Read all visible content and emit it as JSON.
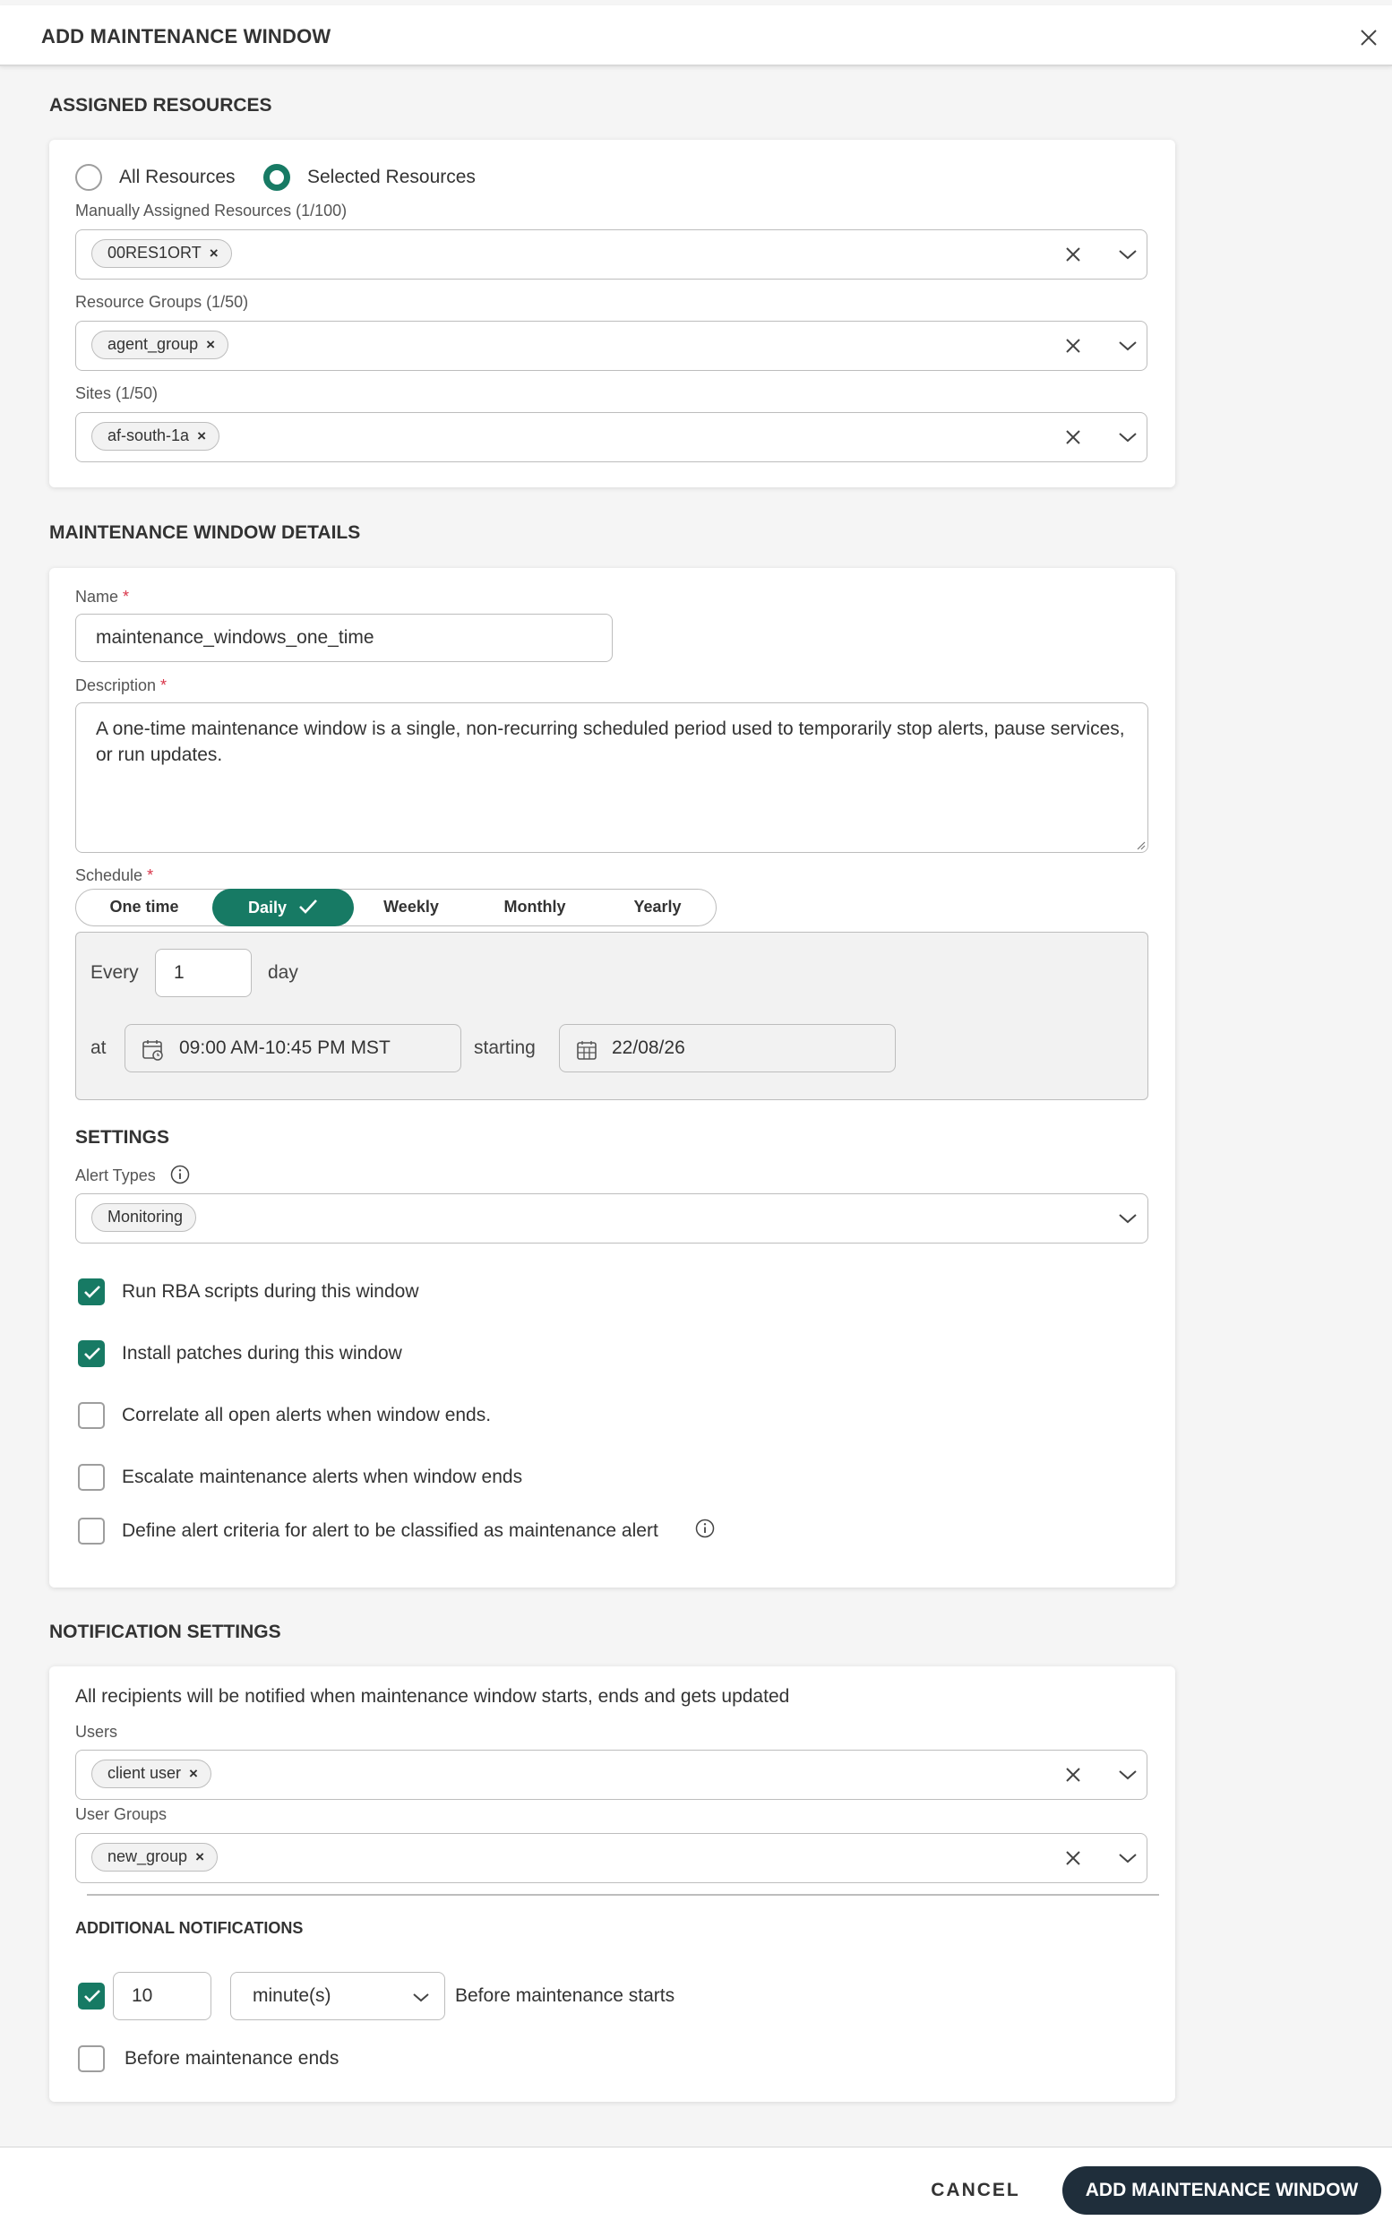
{
  "header": {
    "title": "ADD MAINTENANCE WINDOW"
  },
  "assigned": {
    "section_title": "ASSIGNED RESOURCES",
    "radio_all": "All Resources",
    "radio_selected": "Selected Resources",
    "selected_mode": "Selected Resources",
    "manual_label": "Manually Assigned Resources (1/100)",
    "manual_chip": "00RES1ORT",
    "groups_label": "Resource Groups (1/50)",
    "groups_chip": "agent_group",
    "sites_label": "Sites (1/50)",
    "sites_chip": "af-south-1a"
  },
  "details": {
    "section_title": "MAINTENANCE WINDOW DETAILS",
    "name_label": "Name",
    "name_value": "maintenance_windows_one_time",
    "desc_label": "Description",
    "desc_value": "A one-time maintenance window is a single, non-recurring scheduled period used to temporarily stop alerts, pause services, or run updates.",
    "schedule_label": "Schedule",
    "schedule_options": [
      "One time",
      "Daily",
      "Weekly",
      "Monthly",
      "Yearly"
    ],
    "schedule_selected": "Daily",
    "every_label": "Every",
    "every_value": "1",
    "every_unit": "day",
    "at_label": "at",
    "time_value": "09:00 AM-10:45 PM MST",
    "starting_label": "starting",
    "date_value": "22/08/26"
  },
  "settings": {
    "title": "SETTINGS",
    "alert_types_label": "Alert Types",
    "alert_chip": "Monitoring",
    "checks": [
      {
        "label": "Run RBA scripts during this window",
        "checked": true
      },
      {
        "label": "Install patches during this window",
        "checked": true
      },
      {
        "label": "Correlate all open alerts when window ends.",
        "checked": false
      },
      {
        "label": "Escalate maintenance alerts when window ends",
        "checked": false
      },
      {
        "label": "Define alert criteria for alert to be classified as maintenance alert",
        "checked": false
      }
    ]
  },
  "notifications": {
    "section_title": "NOTIFICATION SETTINGS",
    "intro": "All recipients will be notified when maintenance window starts, ends and gets updated",
    "users_label": "Users",
    "users_chip": "client user",
    "groups_label": "User Groups",
    "groups_chip": "new_group",
    "additional_title": "ADDITIONAL NOTIFICATIONS",
    "before_start_value": "10",
    "before_start_unit": "minute(s)",
    "before_start_label": "Before maintenance starts",
    "before_start_checked": true,
    "before_end_label": "Before maintenance ends",
    "before_end_checked": false
  },
  "footer": {
    "cancel_label": "CANCEL",
    "submit_label": "ADD MAINTENANCE WINDOW"
  },
  "colors": {
    "accent": "#177a64",
    "primary_button": "#1f2e3b"
  }
}
